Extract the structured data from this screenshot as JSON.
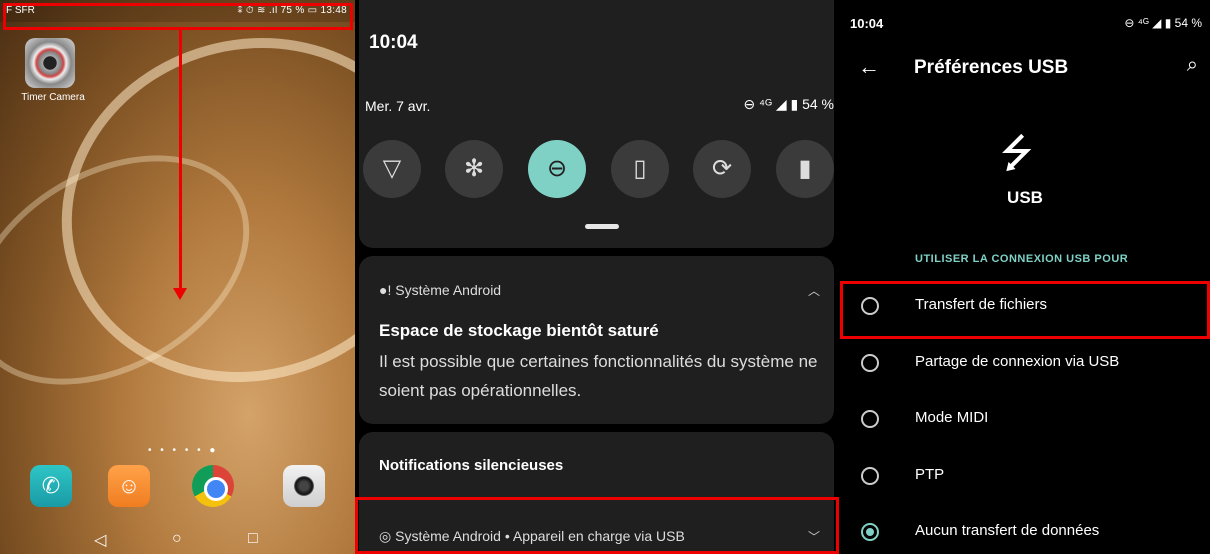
{
  "home": {
    "status_carrier": "F SFR",
    "status_right": "⁑ ⏱ ≋ .ıl 75 % ▭ 13:48",
    "app_label": "Timer Camera",
    "page_dots": "• • • • • ●",
    "nav_back": "◁",
    "nav_home": "○",
    "nav_recents": "□"
  },
  "shade": {
    "time": "10:04",
    "date": "Mer. 7 avr.",
    "status": "⊖ ⁴ᴳ ◢ ▮ 54 %",
    "notification": {
      "app": "Système Android",
      "title": "Espace de stockage bientôt saturé",
      "body": "Il est possible que certaines fonctionnalités du système ne soient pas opérationnelles."
    },
    "silent_header": "Notifications silencieuses",
    "usb_notification": "Système Android • Appareil en charge via USB"
  },
  "usb_prefs": {
    "status_time": "10:04",
    "status_icons": "⊖ ⁴ᴳ ◢ ▮ 54 %",
    "title": "Préférences USB",
    "usb_label": "USB",
    "section": "UTILISER LA CONNEXION USB POUR",
    "options": [
      {
        "label": "Transfert de fichiers",
        "selected": false
      },
      {
        "label": "Partage de connexion via USB",
        "selected": false
      },
      {
        "label": "Mode MIDI",
        "selected": false
      },
      {
        "label": "PTP",
        "selected": false
      },
      {
        "label": "Aucun transfert de données",
        "selected": true
      }
    ]
  },
  "colors": {
    "accent": "#7fd1c6",
    "highlight": "#e00000"
  }
}
